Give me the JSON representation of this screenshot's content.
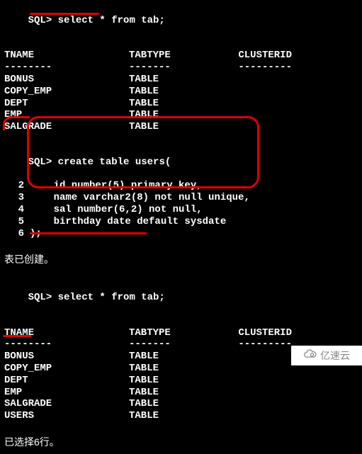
{
  "block1": {
    "prompt": "SQL>",
    "command": "select * from tab;",
    "header": {
      "tname": "TNAME",
      "tabtype": "TABTYPE",
      "clusterid": "CLUSTERID"
    },
    "divider": {
      "c1": "--------",
      "c2": "-------",
      "c3": "---------"
    },
    "rows": [
      {
        "tname": "BONUS",
        "tabtype": "TABLE"
      },
      {
        "tname": "COPY_EMP",
        "tabtype": "TABLE"
      },
      {
        "tname": "DEPT",
        "tabtype": "TABLE"
      },
      {
        "tname": "EMP",
        "tabtype": "TABLE"
      },
      {
        "tname": "SALGRADE",
        "tabtype": "TABLE"
      }
    ]
  },
  "block2": {
    "prompt": "SQL>",
    "command": "create table users(",
    "lines": [
      {
        "no": "2",
        "text": "    id number(5) primary key,"
      },
      {
        "no": "3",
        "text": "    name varchar2(8) not null unique,"
      },
      {
        "no": "4",
        "text": "    sal number(6,2) not null,"
      },
      {
        "no": "5",
        "text": "    birthday date default sysdate"
      },
      {
        "no": "6",
        "text": ");"
      }
    ],
    "result_msg": "表已创建。"
  },
  "block3": {
    "prompt": "SQL>",
    "command": "select * from tab;",
    "header": {
      "tname": "TNAME",
      "tabtype": "TABTYPE",
      "clusterid": "CLUSTERID"
    },
    "divider": {
      "c1": "--------",
      "c2": "-------",
      "c3": "---------"
    },
    "rows": [
      {
        "tname": "BONUS",
        "tabtype": "TABLE"
      },
      {
        "tname": "COPY_EMP",
        "tabtype": "TABLE"
      },
      {
        "tname": "DEPT",
        "tabtype": "TABLE"
      },
      {
        "tname": "EMP",
        "tabtype": "TABLE"
      },
      {
        "tname": "SALGRADE",
        "tabtype": "TABLE"
      },
      {
        "tname": "USERS",
        "tabtype": "TABLE"
      }
    ],
    "result_msg": "已选择6行。"
  },
  "watermark": {
    "text": "亿速云"
  }
}
